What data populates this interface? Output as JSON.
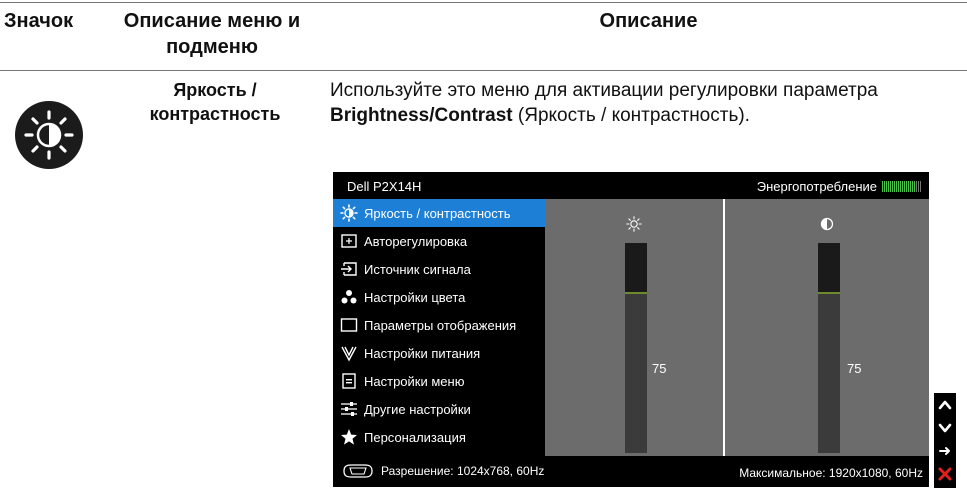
{
  "table": {
    "headers": {
      "icon": "Значок",
      "menu": "Описание меню и подменю",
      "description": "Описание"
    },
    "row": {
      "icon_name": "brightness-contrast-icon",
      "menu_name": "Яркость / контрастность",
      "description_pre": "Используйте это меню для активации регулировки параметра ",
      "description_bold": "Brightness/Contrast",
      "description_post": " (Яркость / контрастность)."
    }
  },
  "osd": {
    "model": "Dell P2X14H",
    "energy_label": "Энергопотребление",
    "energy_level": 0.85,
    "menu_items": [
      {
        "label": "Яркость / контрастность",
        "icon": "brightness-icon",
        "active": true
      },
      {
        "label": "Авторегулировка",
        "icon": "auto-adjust-icon"
      },
      {
        "label": "Источник сигнала",
        "icon": "input-source-icon"
      },
      {
        "label": "Настройки цвета",
        "icon": "color-settings-icon"
      },
      {
        "label": "Параметры отображения",
        "icon": "display-settings-icon"
      },
      {
        "label": "Настройки питания",
        "icon": "power-settings-icon"
      },
      {
        "label": "Настройки меню",
        "icon": "menu-settings-icon"
      },
      {
        "label": "Другие настройки",
        "icon": "other-settings-icon"
      },
      {
        "label": "Персонализация",
        "icon": "personalize-star-icon"
      }
    ],
    "brightness": {
      "icon": "sun-icon",
      "value": "75"
    },
    "contrast": {
      "icon": "contrast-icon",
      "value": "75"
    },
    "footer": {
      "resolution": "Разрешение: 1024x768, 60Hz",
      "max_resolution": "Максимальное: 1920x1080, 60Hz",
      "icon": "vga-connector-icon"
    }
  },
  "side_buttons": [
    {
      "icon": "up-arrow-icon"
    },
    {
      "icon": "down-arrow-icon"
    },
    {
      "icon": "right-arrow-icon"
    },
    {
      "icon": "close-x-icon",
      "color": "#e0201b"
    }
  ],
  "colors": {
    "osd_background": "#000000",
    "active_item": "#1e7fd6",
    "panel": "#6c6c6c",
    "energy_bar": "#49c24a"
  }
}
